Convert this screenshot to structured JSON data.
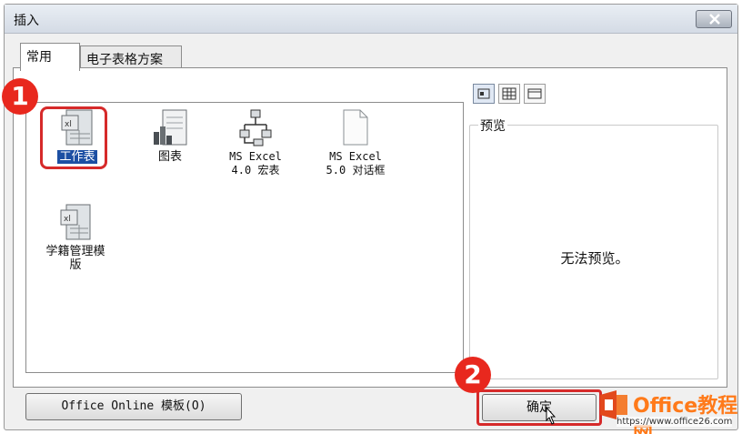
{
  "window": {
    "title": "插入"
  },
  "tabs": [
    {
      "label": "常用",
      "active": true
    },
    {
      "label": "电子表格方案",
      "active": false
    }
  ],
  "items": [
    {
      "label": "工作表",
      "icon": "worksheet-icon",
      "selected": true
    },
    {
      "label": "图表",
      "icon": "chart-icon",
      "selected": false
    },
    {
      "label": "MS Excel\n4.0 宏表",
      "icon": "macro-sheet-icon",
      "selected": false
    },
    {
      "label": "MS Excel\n5.0 对话框",
      "icon": "dialog-sheet-icon",
      "selected": false
    },
    {
      "label": "学籍管理模\n版",
      "icon": "template-icon",
      "selected": false
    }
  ],
  "view_buttons": [
    "large-icons-view",
    "list-view",
    "details-view"
  ],
  "preview": {
    "title": "预览",
    "message": "无法预览。"
  },
  "buttons": {
    "office_online": "Office Online 模板(O)",
    "ok": "确定"
  },
  "annotations": {
    "step1": "1",
    "step2": "2",
    "accent": "#e8281e"
  },
  "watermark": {
    "name": "Office教程网",
    "url": "https://www.office26.com"
  }
}
